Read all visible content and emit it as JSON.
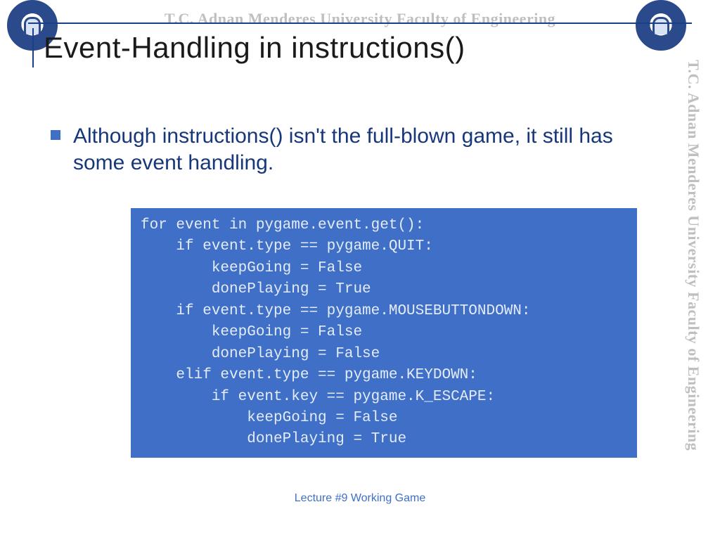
{
  "watermark": "T.C.   Adnan Menderes University   Faculty of Engineering",
  "title": "Event-Handling in instructions()",
  "bullet": "Although instructions() isn't the full-blown game, it still has some event handling.",
  "code": "for event in pygame.event.get():\n    if event.type == pygame.QUIT:\n        keepGoing = False\n        donePlaying = True\n    if event.type == pygame.MOUSEBUTTONDOWN:\n        keepGoing = False\n        donePlaying = False\n    elif event.type == pygame.KEYDOWN:\n        if event.key == pygame.K_ESCAPE:\n            keepGoing = False\n            donePlaying = True",
  "footer": "Lecture #9 Working Game"
}
